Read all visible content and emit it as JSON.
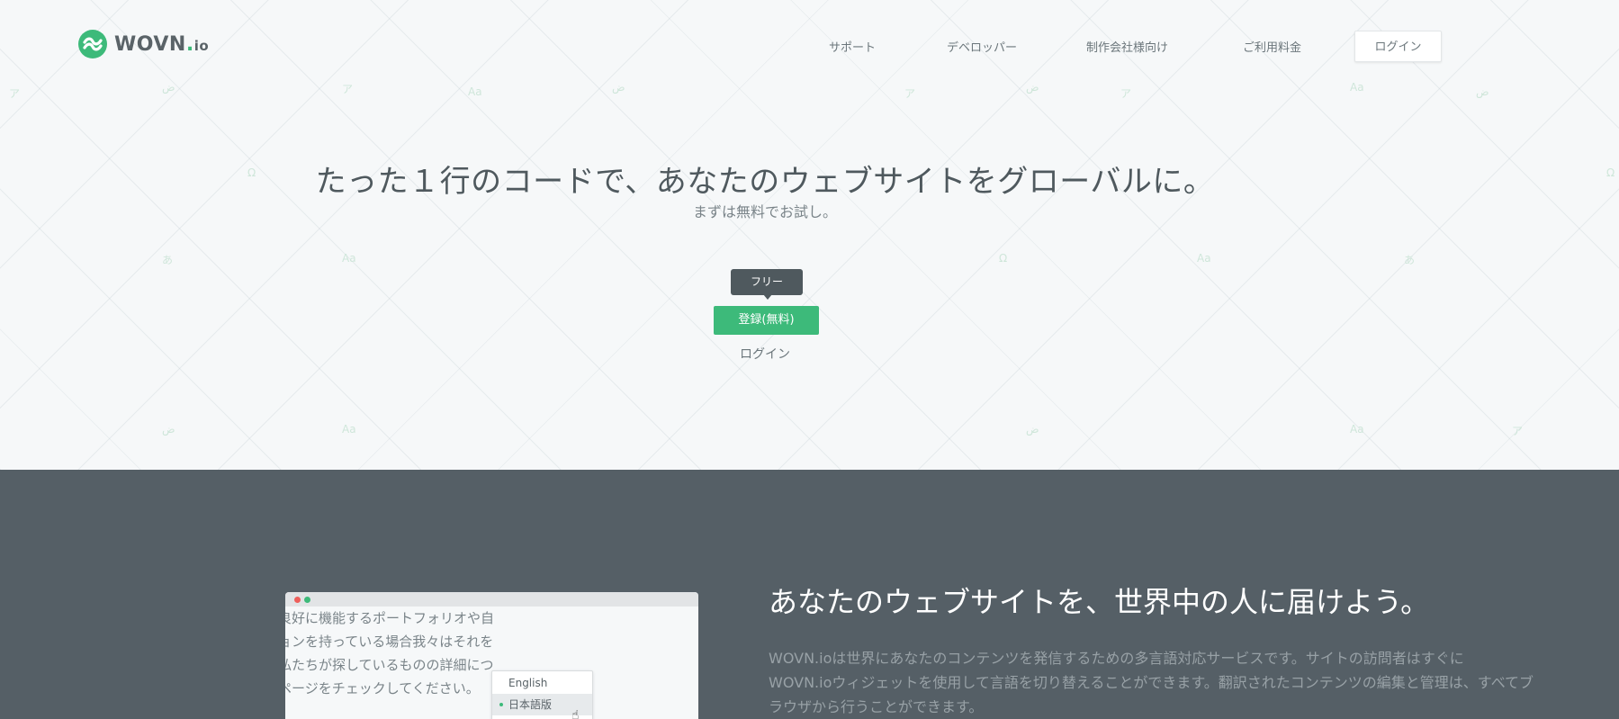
{
  "brand": {
    "name_main": "WOVN",
    "name_dot": ".",
    "name_suffix": "io",
    "accent_color": "#3dba7a",
    "logo_icon": "wovn-wave-icon"
  },
  "nav": {
    "items": [
      {
        "label": "サポート"
      },
      {
        "label": "デベロッパー"
      },
      {
        "label": "制作会社様向け"
      },
      {
        "label": "ご利用料金"
      }
    ],
    "login_label": "ログイン"
  },
  "hero": {
    "headline": "たった１行のコードで、あなたのウェブサイトをグローバルに。",
    "subline": "まずは無料でお試し。",
    "tooltip": "フリー",
    "signup_label": "登録(無料)",
    "login_label": "ログイン"
  },
  "feature": {
    "title": "あなたのウェブサイトを、世界中の人に届けよう。",
    "body_lines": [
      "WOVN.ioは世界にあなたのコンテンツを発信するための多言語対応サービスです。サイトの訪問者はすぐに",
      "WOVN.ioウィジェットを使用して言語を切り替えることができます。翻訳されたコンテンツの編集と管理は、すべてブ",
      "ラウザから行うことができます。"
    ]
  },
  "mockup": {
    "lines": [
      "良好に機能するポートフォリオや自",
      "ョンを持っている場合我々はそれを",
      "私たちが探しているものの詳細につ",
      "ページをチェックしてください。"
    ],
    "lang_options": [
      {
        "label": "English",
        "selected": false
      },
      {
        "label": "日本語版",
        "selected": true
      }
    ]
  }
}
